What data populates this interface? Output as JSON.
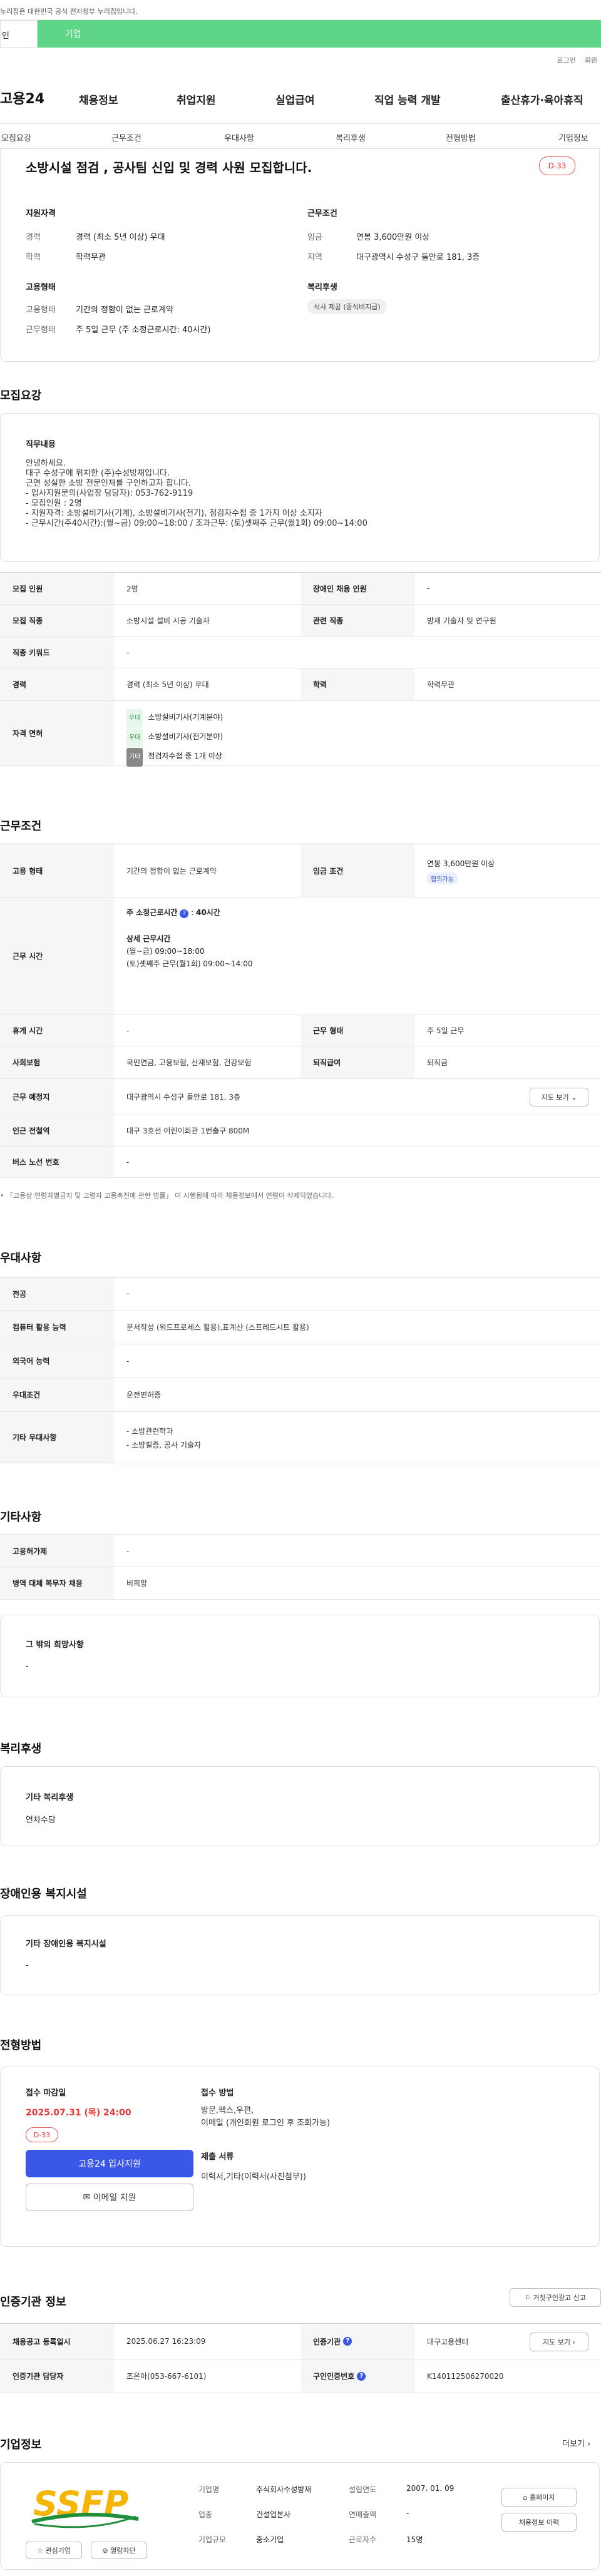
{
  "topbar": {
    "notice": "누리집은 대한민국 공식 전자정부 누리집입니다."
  },
  "tabs": {
    "individual": "인",
    "company": "기업"
  },
  "util": {
    "login": "로그인",
    "join": "회원"
  },
  "gnb": {
    "logo": "고용24",
    "items": [
      "채용정보",
      "취업지원",
      "실업급여",
      "직업 능력 개발",
      "출산휴가·육아휴직"
    ]
  },
  "subnav": [
    "모집요강",
    "근무조건",
    "우대사항",
    "복리후생",
    "전형방법",
    "기업정보"
  ],
  "summary": {
    "title": "소방시설 점검 , 공사팀 신입 및 경력 사원 모집합니다.",
    "dday": "D-33",
    "qual_h": "지원자격",
    "qual_career_l": "경력",
    "qual_career_v": "경력 (최소 5년 이상) 우대",
    "qual_edu_l": "학력",
    "qual_edu_v": "학력무관",
    "cond_h": "근무조건",
    "cond_wage_l": "임금",
    "cond_wage_v": "연봉 3,600만원 이상",
    "cond_loc_l": "지역",
    "cond_loc_v": "대구광역시 수성구 들안로 181, 3층",
    "emp_h": "고용형태",
    "emp_type_l": "고용형태",
    "emp_type_v": "기간의 정함이 없는 근로계약",
    "emp_form_l": "근무형태",
    "emp_form_v": "주 5일 근무 (주 소정근로시간: 40시간)",
    "welfare_h": "복리후생",
    "welfare_tag": "식사 제공 (중식비지급)"
  },
  "recruit": {
    "heading": "모집요강",
    "duty_h": "직무내용",
    "duty_lines": [
      "안녕하세요.",
      "대구 수성구에 위치한 (주)수성방재입니다.",
      "근면 성실한 소방 전문인재를 구인하고자 합니다.",
      "- 입사지원문의(사업장 담당자): 053-762-9119",
      "- 모집인원 : 2명",
      "- 지원자격: 소방설비기사(기계),  소방설비기사(전기), 점검자수첩 중 1가지 이상 소지자",
      "- 근무시간(주40시간):(월~금) 09:00~18:00 /  조과근무: (토)셋째주 근무(월1회) 09:00~14:00"
    ],
    "r1": {
      "h1": "모집 인원",
      "v1": "2명",
      "h2": "장애인 채용 인원",
      "v2": "-"
    },
    "r2": {
      "h1": "모집 직종",
      "v1": "소방시설 설비 시공 기술자",
      "h2": "관련 직종",
      "v2": "방재 기술자 및 연구원"
    },
    "r3": {
      "h1": "직종 키워드",
      "v1": "-"
    },
    "r4": {
      "h1": "경력",
      "v1": "경력 (최소 5년 이상) 우대",
      "h2": "학력",
      "v2": "학력무관"
    },
    "r5": {
      "h1": "자격 면허",
      "lic": [
        {
          "tag": "우대",
          "name": "소방설비기사(기계분야)"
        },
        {
          "tag": "우대",
          "name": "소방설비기사(전기분야)"
        },
        {
          "tag": "기타",
          "name": "점검자수첩 중 1개 이상"
        }
      ]
    }
  },
  "work": {
    "heading": "근무조건",
    "r1": {
      "h1": "고용 형태",
      "v1": "기간의 정함이 없는 근로계약",
      "h2": "임금 조건",
      "v2": "연봉 3,600만원 이상",
      "v2b": "협의가능"
    },
    "r2": {
      "h1": "근무 시간",
      "weekly_l": "주 소정근로시간",
      "weekly_v": "40시간",
      "detail_l": "상세 근무시간",
      "detail1": "(월~금) 09:00~18:00",
      "detail2": "(토)셋째주 근무(월1회) 09:00~14:00"
    },
    "r3": {
      "h1": "휴게 시간",
      "v1": "-",
      "h2": "근무 형태",
      "v2": "주 5일 근무"
    },
    "r4": {
      "h1": "사회보험",
      "v1": "국민연금, 고용보험, 산재보험, 건강보험",
      "h2": "퇴직급여",
      "v2": "퇴직금"
    },
    "r5": {
      "h1": "근무 예정지",
      "v1": "대구광역시 수성구 들안로 181, 3층",
      "btn": "지도 보기"
    },
    "r6": {
      "h1": "인근 전철역",
      "v1": "대구 3호선 어린이회관 1번출구 800M"
    },
    "r7": {
      "h1": "버스 노선 번호",
      "v1": "-"
    },
    "note": "「고용상 연령차별금지 및 고령자 고용촉진에 관한 법률」 이 시행됨에 따라 채용정보에서 연령이 삭제되었습니다."
  },
  "pref": {
    "heading": "우대사항",
    "r1": {
      "h": "전공",
      "v": "-"
    },
    "r2": {
      "h": "컴퓨터 활용 능력",
      "v": "문서작성 (워드프로세스 활용),표계산 (스프레드시트 활용)"
    },
    "r3": {
      "h": "외국어 능력",
      "v": "-"
    },
    "r4": {
      "h": "우대조건",
      "v": "운전면허증"
    },
    "r5": {
      "h": "기타 우대사항",
      "v1": "- 소방관련학과",
      "v2": "- 소방필증, 공사 기술자"
    }
  },
  "etc": {
    "heading": "기타사항",
    "r1": {
      "h": "고용허가제",
      "v": "-"
    },
    "r2": {
      "h": "병역 대체 복무자 채용",
      "v": "비희망"
    },
    "box_h": "그 밖의 희망사항",
    "box_v": "-"
  },
  "welfare": {
    "heading": "복리후생",
    "box_h": "기타 복리후생",
    "box_v": "연차수당"
  },
  "disabled": {
    "heading": "장애인용 복지시설",
    "box_h": "기타 장애인용 복지시설",
    "box_v": "-"
  },
  "process": {
    "heading": "전형방법",
    "deadline_h": "접수 마감일",
    "deadline_v": "2025.07.31 (목) 24:00",
    "dday": "D-33",
    "apply_btn": "고용24 입사지원",
    "email_btn": "이메일 지원",
    "method_h": "접수 방법",
    "method_v1": "방문,팩스,우편,",
    "method_v2": "이메일 (개인회원 로그인 후 조회가능)",
    "docs_h": "제출 서류",
    "docs_v": "이력서,기타(이력서(사진첨부))"
  },
  "agency": {
    "heading": "인증기관 정보",
    "report_btn": "거짓구인광고 신고",
    "r1": {
      "h1": "채용공고 등록일시",
      "v1": "2025.06.27 16:23:09",
      "h2": "인증기관",
      "v2": "대구고용센터",
      "btn": "지도 보기"
    },
    "r2": {
      "h1": "인증기관 담당자",
      "v1": "조은아(053-667-6101)",
      "h2": "구인인증번호",
      "v2": "K140112506270020"
    }
  },
  "company": {
    "heading": "기업정보",
    "more": "더보기",
    "logo_text": "SSFP",
    "name_l": "기업명",
    "name_v": "주식회사수성방재",
    "est_l": "설립연도",
    "est_v": "2007. 01. 09",
    "ind_l": "업종",
    "ind_v": "건설업본사",
    "sales_l": "연매출액",
    "sales_v": "-",
    "size_l": "기업규모",
    "size_v": "중소기업",
    "emp_l": "근로자수",
    "emp_v": "15명",
    "fav_btn": "관심기업",
    "block_btn": "열람차단",
    "home_btn": "홈페이지",
    "jobs_btn": "채용정보 이력"
  },
  "colors": {
    "accent": "#3a57e8",
    "green": "#5fd587",
    "danger": "#e53935"
  }
}
